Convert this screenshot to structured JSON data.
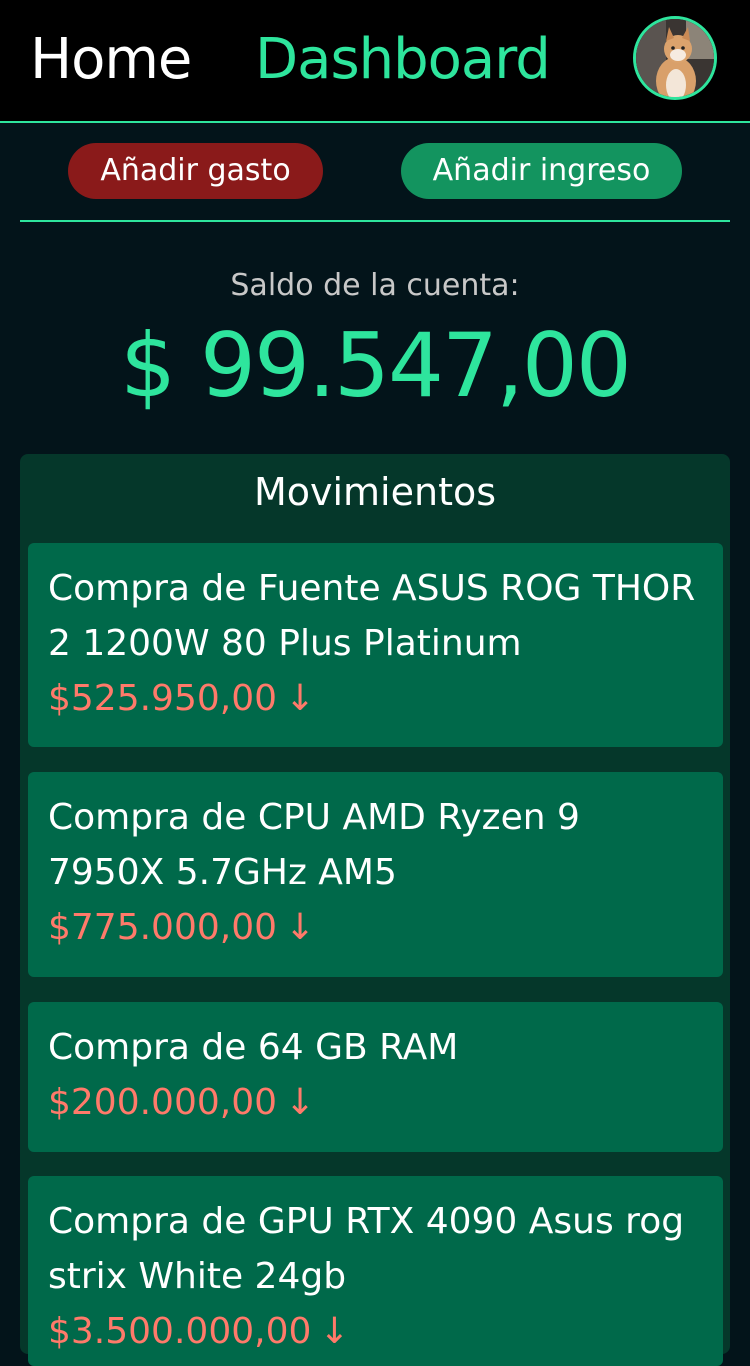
{
  "nav": {
    "home": "Home",
    "dashboard": "Dashboard",
    "avatar_icon": "cat-avatar-icon"
  },
  "actions": {
    "add_expense": "Añadir gasto",
    "add_income": "Añadir ingreso"
  },
  "balance": {
    "label": "Saldo de la cuenta:",
    "value": "$ 99.547,00"
  },
  "movements": {
    "title": "Movimientos",
    "items": [
      {
        "title": "Compra de Fuente ASUS ROG THOR 2 1200W 80 Plus Platinum",
        "amount": "$525.950,00",
        "direction_icon": "arrow-down-icon"
      },
      {
        "title": "Compra de CPU AMD Ryzen 9 7950X 5.7GHz AM5",
        "amount": "$775.000,00",
        "direction_icon": "arrow-down-icon"
      },
      {
        "title": "Compra de 64 GB RAM",
        "amount": "$200.000,00",
        "direction_icon": "arrow-down-icon"
      },
      {
        "title": "Compra de GPU RTX 4090 Asus rog strix White 24gb",
        "amount": "$3.500.000,00",
        "direction_icon": "arrow-down-icon"
      }
    ]
  },
  "colors": {
    "accent": "#2ee59d",
    "background": "#03141a",
    "expense_button": "#8a1a1a",
    "income_button": "#13945f",
    "card": "#00694a",
    "expense_amount": "#ff7a6a"
  }
}
